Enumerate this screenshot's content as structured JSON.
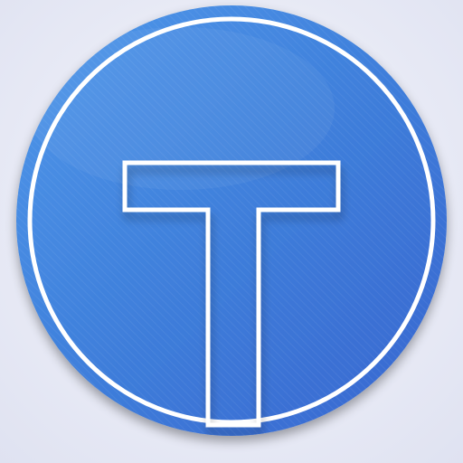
{
  "icon": {
    "name": "letter-t-app-icon",
    "glyph": "T",
    "colors": {
      "background": "#eceef8",
      "disc_light": "#4f98ea",
      "disc_mid": "#3f7fdb",
      "disc_dark": "#3765cf",
      "ring": "#ffffff",
      "glyph_outline": "#ffffff"
    }
  }
}
